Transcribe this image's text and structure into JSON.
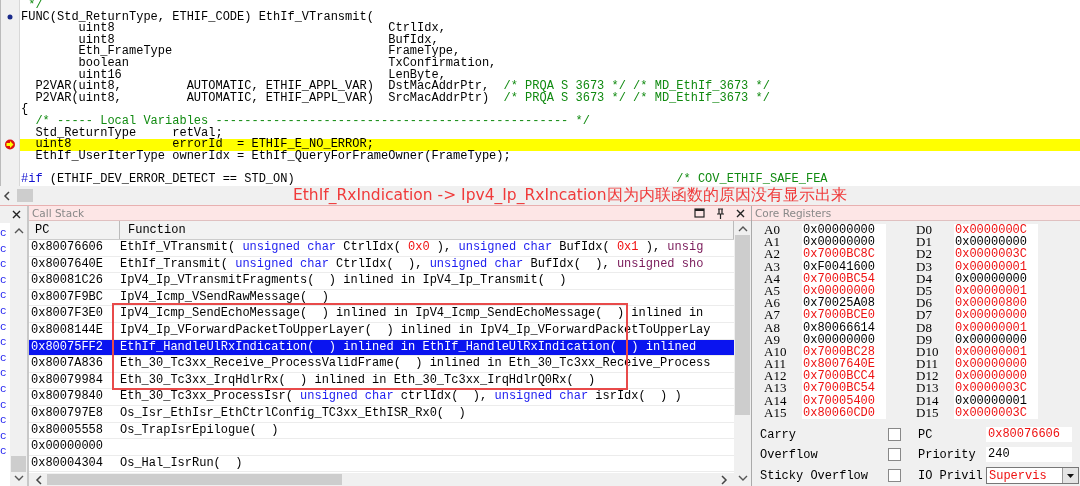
{
  "editor": {
    "lines": [
      {
        "current": false,
        "segments": [
          {
            "kind": "comment",
            "text": " */"
          }
        ]
      },
      {
        "current": false,
        "kind": "bookmark",
        "segments": [
          {
            "kind": "code",
            "text": "FUNC(Std_ReturnType, ETHIF_CODE) EthIf_VTransmit("
          }
        ]
      },
      {
        "current": false,
        "segments": [
          {
            "kind": "code",
            "text": "        uint8                                      CtrlIdx,"
          }
        ]
      },
      {
        "current": false,
        "segments": [
          {
            "kind": "code",
            "text": "        uint8                                      BufIdx,"
          }
        ]
      },
      {
        "current": false,
        "segments": [
          {
            "kind": "code",
            "text": "        Eth_FrameType                              FrameType,"
          }
        ]
      },
      {
        "current": false,
        "segments": [
          {
            "kind": "code",
            "text": "        boolean                                    TxConfirmation,"
          }
        ]
      },
      {
        "current": false,
        "segments": [
          {
            "kind": "code",
            "text": "        uint16                                     LenByte,"
          }
        ]
      },
      {
        "current": false,
        "segments": [
          {
            "kind": "code",
            "text": "  P2VAR(uint8,         AUTOMATIC, ETHIF_APPL_VAR)  DstMacAddrPtr,  "
          },
          {
            "kind": "comment",
            "text": "/* PRQA S 3673 */ /* MD_EthIf_3673 */"
          }
        ]
      },
      {
        "current": false,
        "segments": [
          {
            "kind": "code",
            "text": "  P2VAR(uint8,         AUTOMATIC, ETHIF_APPL_VAR)  SrcMacAddrPtr)  "
          },
          {
            "kind": "comment",
            "text": "/* PRQA S 3673 */ /* MD_EthIf_3673 */"
          }
        ]
      },
      {
        "current": false,
        "segments": [
          {
            "kind": "code",
            "text": "{"
          }
        ]
      },
      {
        "current": false,
        "segments": [
          {
            "kind": "comment",
            "text": "  /* ----- Local Variables ------------------------------------------------- */"
          }
        ]
      },
      {
        "current": false,
        "segments": [
          {
            "kind": "code",
            "text": "  Std_ReturnType     retVal;"
          }
        ]
      },
      {
        "current": true,
        "kind": "exec",
        "segments": [
          {
            "kind": "code",
            "text": "  uint8              errorId  = ETHIF_E_NO_ERROR;"
          }
        ]
      },
      {
        "current": false,
        "segments": [
          {
            "kind": "code",
            "text": "  EthIf_UserIterType ownerIdx = EthIf_QueryForFrameOwner(FrameType);"
          }
        ]
      },
      {
        "current": false
      },
      {
        "current": false,
        "segments": [
          {
            "kind": "preproc",
            "text": "#if"
          },
          {
            "kind": "code",
            "text": " (ETHIF_DEV_ERROR_DETECT == STD_ON)                                                     "
          },
          {
            "kind": "comment",
            "text": "/* COV_ETHIF_SAFE_FEA"
          }
        ]
      }
    ]
  },
  "annotation": {
    "text": "EthIf_RxIndication -> Ipv4_Ip_RxIncation因为内联函数的原因没有显示出来"
  },
  "side_panel": {
    "items": [
      "c",
      "c",
      "c",
      "c",
      "c",
      "c",
      "c",
      "c",
      "c",
      "c",
      "c",
      "c",
      "c",
      "c",
      "c"
    ]
  },
  "call_stack": {
    "title": "Call Stack",
    "columns": [
      "PC",
      "Function"
    ],
    "rows": [
      {
        "pc": "0x80076606",
        "selected": false,
        "boxed": false,
        "function": [
          {
            "kind": "name",
            "text": "EthIf_VTransmit( "
          },
          {
            "kind": "type",
            "text": "unsigned char"
          },
          {
            "kind": "name",
            "text": " CtrlIdx( "
          },
          {
            "kind": "value",
            "text": "0x0"
          },
          {
            "kind": "name",
            "text": " ), "
          },
          {
            "kind": "type",
            "text": "unsigned char"
          },
          {
            "kind": "name",
            "text": " BufIdx( "
          },
          {
            "kind": "value",
            "text": "0x1"
          },
          {
            "kind": "name",
            "text": " ), "
          },
          {
            "kind": "type2",
            "text": "unsig"
          }
        ]
      },
      {
        "pc": "0x8007640E",
        "selected": false,
        "boxed": false,
        "function": [
          {
            "kind": "name",
            "text": "EthIf_Transmit( "
          },
          {
            "kind": "type",
            "text": "unsigned char"
          },
          {
            "kind": "name",
            "text": " CtrlIdx(  ), "
          },
          {
            "kind": "type",
            "text": "unsigned char"
          },
          {
            "kind": "name",
            "text": " BufIdx(  ), "
          },
          {
            "kind": "type2",
            "text": "unsigned sho"
          }
        ]
      },
      {
        "pc": "0x80081C26",
        "selected": false,
        "boxed": false,
        "function": [
          {
            "kind": "name",
            "text": "IpV4_Ip_VTransmitFragments(  ) inlined in IpV4_Ip_Transmit(  )"
          }
        ]
      },
      {
        "pc": "0x8007F9BC",
        "selected": false,
        "boxed": false,
        "function": [
          {
            "kind": "name",
            "text": "IpV4_Icmp_VSendRawMessage(  )"
          }
        ]
      },
      {
        "pc": "0x8007F3E0",
        "selected": false,
        "boxed": true,
        "function": [
          {
            "kind": "name",
            "text": "IpV4_Icmp_SendEchoMessage(  ) inlined in IpV4_Icmp_SendEchoMessage(  ) inlined in"
          }
        ]
      },
      {
        "pc": "0x8008144E",
        "selected": false,
        "boxed": true,
        "function": [
          {
            "kind": "name",
            "text": "IpV4_Ip_VForwardPacketToUpperLayer(  ) inlined in IpV4_Ip_VForwardPacketToUpperLay"
          }
        ]
      },
      {
        "pc": "0x80075FF2",
        "selected": true,
        "boxed": true,
        "function": [
          {
            "kind": "name",
            "text": "EthIf_HandleUlRxIndication(  ) inlined in EthIf_HandleUlRxIndication(  ) inlined"
          }
        ]
      },
      {
        "pc": "0x8007A836",
        "selected": false,
        "boxed": true,
        "function": [
          {
            "kind": "name",
            "text": "Eth_30_Tc3xx_Receive_ProcessValidFrame(  ) inlined in Eth_30_Tc3xx_Receive_Process"
          }
        ]
      },
      {
        "pc": "0x80079984",
        "selected": false,
        "boxed": true,
        "function": [
          {
            "kind": "name",
            "text": "Eth_30_Tc3xx_IrqHdlrRx(  ) inlined in Eth_30_Tc3xx_IrqHdlrQ0Rx(  )"
          }
        ]
      },
      {
        "pc": "0x80079840",
        "selected": false,
        "boxed": false,
        "function": [
          {
            "kind": "name",
            "text": "Eth_30_Tc3xx_ProcessIsr( "
          },
          {
            "kind": "type",
            "text": "unsigned char"
          },
          {
            "kind": "name",
            "text": " ctrlIdx(  ), "
          },
          {
            "kind": "type",
            "text": "unsigned char"
          },
          {
            "kind": "name",
            "text": " isrIdx(  ) )"
          }
        ]
      },
      {
        "pc": "0x800797E8",
        "selected": false,
        "boxed": false,
        "function": [
          {
            "kind": "name",
            "text": "Os_Isr_EthIsr_EthCtrlConfig_TC3xx_EthISR_Rx0(  )"
          }
        ]
      },
      {
        "pc": "0x80005558",
        "selected": false,
        "boxed": false,
        "function": [
          {
            "kind": "name",
            "text": "Os_TrapIsrEpilogue(  )"
          }
        ]
      },
      {
        "pc": "0x00000000",
        "selected": false,
        "boxed": false,
        "function": []
      },
      {
        "pc": "0x80004304",
        "selected": false,
        "boxed": false,
        "function": [
          {
            "kind": "name",
            "text": "Os_Hal_IsrRun(  )"
          }
        ]
      }
    ]
  },
  "core_registers": {
    "title": "Core Registers",
    "rows": [
      [
        {
          "name": "A0",
          "value": "0x00000000",
          "changed": false
        },
        {
          "name": "D0",
          "value": "0x0000000C",
          "changed": true
        }
      ],
      [
        {
          "name": "A1",
          "value": "0x00000000",
          "changed": false
        },
        {
          "name": "D1",
          "value": "0x00000000",
          "changed": false
        }
      ],
      [
        {
          "name": "A2",
          "value": "0x7000BC8C",
          "changed": true
        },
        {
          "name": "D2",
          "value": "0x0000003C",
          "changed": true
        }
      ],
      [
        {
          "name": "A3",
          "value": "0xF0041600",
          "changed": false
        },
        {
          "name": "D3",
          "value": "0x00000001",
          "changed": true
        }
      ],
      [
        {
          "name": "A4",
          "value": "0x7000BC54",
          "changed": true
        },
        {
          "name": "D4",
          "value": "0x00000000",
          "changed": false
        }
      ],
      [
        {
          "name": "A5",
          "value": "0x00000000",
          "changed": true
        },
        {
          "name": "D5",
          "value": "0x00000001",
          "changed": true
        }
      ],
      [
        {
          "name": "A6",
          "value": "0x70025A08",
          "changed": false
        },
        {
          "name": "D6",
          "value": "0x00000800",
          "changed": true
        }
      ],
      [
        {
          "name": "A7",
          "value": "0x7000BCE0",
          "changed": true
        },
        {
          "name": "D7",
          "value": "0x00000000",
          "changed": true
        }
      ],
      [
        {
          "name": "A8",
          "value": "0x80066614",
          "changed": false
        },
        {
          "name": "D8",
          "value": "0x00000001",
          "changed": true
        }
      ],
      [
        {
          "name": "A9",
          "value": "0x00000000",
          "changed": false
        },
        {
          "name": "D9",
          "value": "0x00000000",
          "changed": false
        }
      ],
      [
        {
          "name": "A10",
          "value": "0x7000BC28",
          "changed": true
        },
        {
          "name": "D10",
          "value": "0x00000001",
          "changed": true
        }
      ],
      [
        {
          "name": "A11",
          "value": "0x8007640E",
          "changed": true
        },
        {
          "name": "D11",
          "value": "0x00000000",
          "changed": true
        }
      ],
      [
        {
          "name": "A12",
          "value": "0x7000BCC4",
          "changed": true
        },
        {
          "name": "D12",
          "value": "0x00000000",
          "changed": true
        }
      ],
      [
        {
          "name": "A13",
          "value": "0x7000BC54",
          "changed": true
        },
        {
          "name": "D13",
          "value": "0x0000003C",
          "changed": true
        }
      ],
      [
        {
          "name": "A14",
          "value": "0x70005400",
          "changed": true
        },
        {
          "name": "D14",
          "value": "0x00000001",
          "changed": false
        }
      ],
      [
        {
          "name": "A15",
          "value": "0x80060CD0",
          "changed": true
        },
        {
          "name": "D15",
          "value": "0x0000003C",
          "changed": true
        }
      ]
    ],
    "flags": [
      {
        "label": "Carry",
        "checked": false
      },
      {
        "label": "Overflow",
        "checked": false
      },
      {
        "label": "Sticky Overflow",
        "checked": false
      }
    ],
    "fields": [
      {
        "kind": "text",
        "label": "PC",
        "value": "0x80076606",
        "changed": true
      },
      {
        "kind": "text",
        "label": "Priority",
        "value": "240",
        "changed": false
      },
      {
        "kind": "dropdown",
        "label": "IO Privil",
        "value": "Supervis",
        "changed": true
      }
    ]
  }
}
